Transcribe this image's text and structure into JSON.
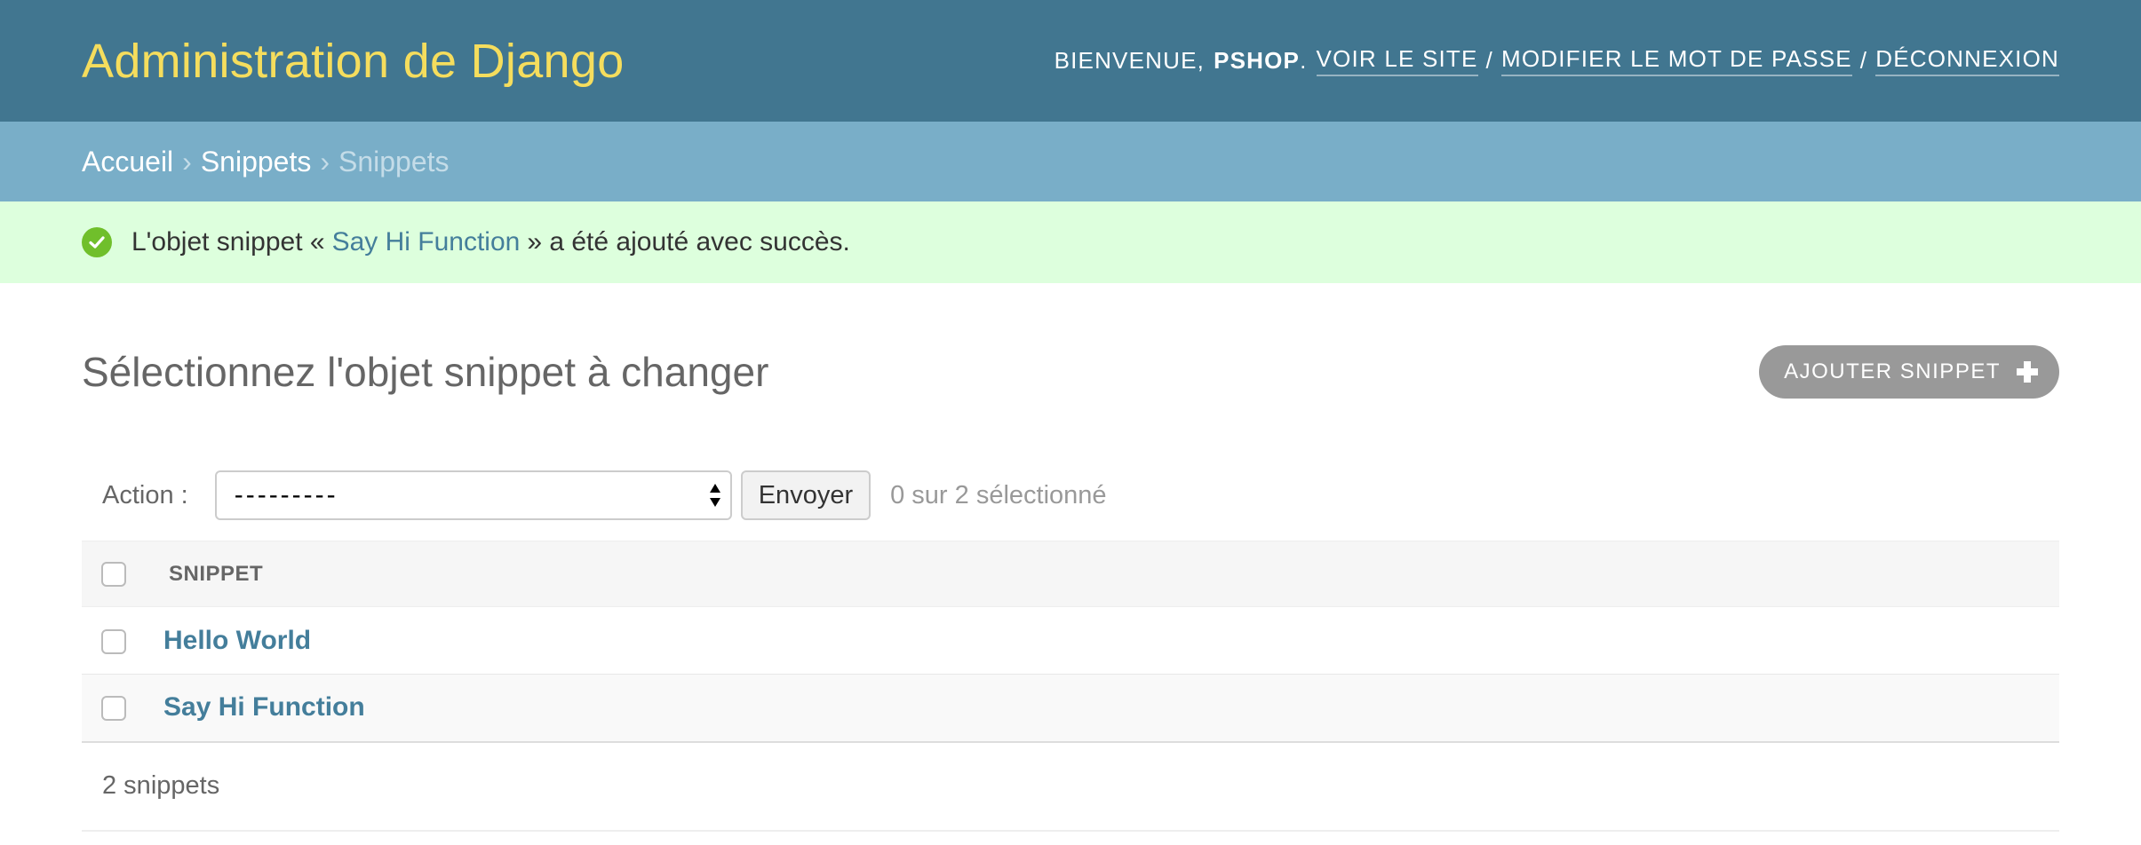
{
  "header": {
    "branding": "Administration de Django",
    "user_tools": {
      "welcome": "Bienvenue,",
      "username": "pshop",
      "period": ".",
      "view_site": "Voir le site",
      "sep1": "/",
      "change_password": "Modifier le mot de passe",
      "sep2": "/",
      "logout": "Déconnexion"
    }
  },
  "breadcrumbs": {
    "home": "Accueil",
    "sep1": "›",
    "app": "Snippets",
    "sep2": "›",
    "current": "Snippets"
  },
  "message": {
    "before": "L'objet snippet «",
    "link": "Say Hi Function",
    "after": "» a été ajouté avec succès.",
    "icon": "check-circle-icon",
    "color": "#70bf2b"
  },
  "main": {
    "title": "Sélectionnez l'objet snippet à changer",
    "add_button": "Ajouter snippet"
  },
  "actions": {
    "label": "Action :",
    "select_value": "---------",
    "go_button": "Envoyer",
    "selected_count": "0 sur 2 sélectionné"
  },
  "table": {
    "column_header": "Snippet",
    "rows": [
      {
        "label": "Hello World"
      },
      {
        "label": "Say Hi Function"
      }
    ]
  },
  "paginator": "2 snippets",
  "colors": {
    "header_bg": "#417690",
    "branding": "#f5dd5d",
    "breadcrumbs_bg": "#79aec8",
    "message_bg": "#ddffdd",
    "link": "#447e9b"
  }
}
